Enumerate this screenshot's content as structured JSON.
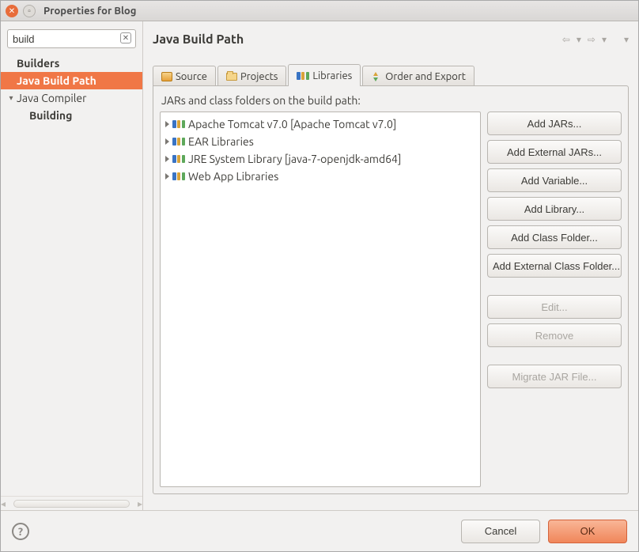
{
  "titlebar": {
    "title": "Properties for Blog"
  },
  "sidebar": {
    "search_value": "build",
    "items": [
      {
        "label": "Builders",
        "depth": 0,
        "bold": true,
        "twisty": "",
        "selected": false
      },
      {
        "label": "Java Build Path",
        "depth": 0,
        "bold": true,
        "twisty": "",
        "selected": true
      },
      {
        "label": "Java Compiler",
        "depth": 0,
        "bold": false,
        "twisty": "▾",
        "selected": false
      },
      {
        "label": "Building",
        "depth": 1,
        "bold": true,
        "twisty": "",
        "selected": false
      }
    ]
  },
  "panel": {
    "title": "Java Build Path",
    "tabs": {
      "source": "Source",
      "projects": "Projects",
      "libraries": "Libraries",
      "order": "Order and Export"
    },
    "desc": "JARs and class folders on the build path:",
    "jars": [
      "Apache Tomcat v7.0 [Apache Tomcat v7.0]",
      "EAR Libraries",
      "JRE System Library [java-7-openjdk-amd64]",
      "Web App Libraries"
    ],
    "buttons": {
      "add_jars": "Add JARs...",
      "add_ext_jars": "Add External JARs...",
      "add_var": "Add Variable...",
      "add_lib": "Add Library...",
      "add_cf": "Add Class Folder...",
      "add_ext_cf": "Add External Class Folder...",
      "edit": "Edit...",
      "remove": "Remove",
      "migrate": "Migrate JAR File..."
    }
  },
  "bottom": {
    "cancel": "Cancel",
    "ok": "OK"
  }
}
